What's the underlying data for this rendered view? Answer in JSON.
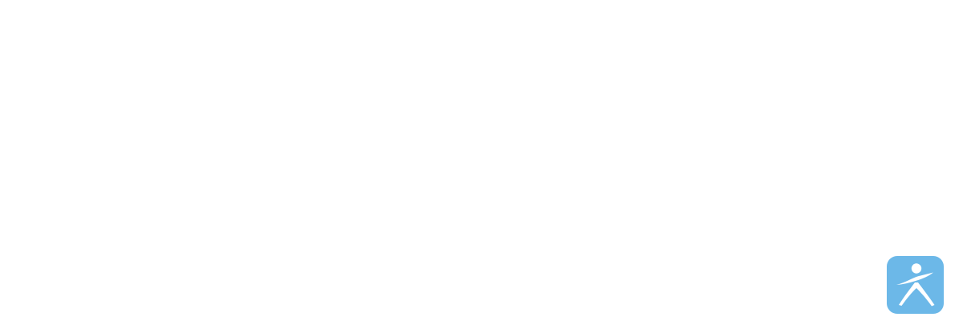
{
  "accessibility_widget": {
    "icon": "accessibility-person-icon",
    "background_color": "#6cb8e8",
    "icon_color": "#ffffff"
  }
}
